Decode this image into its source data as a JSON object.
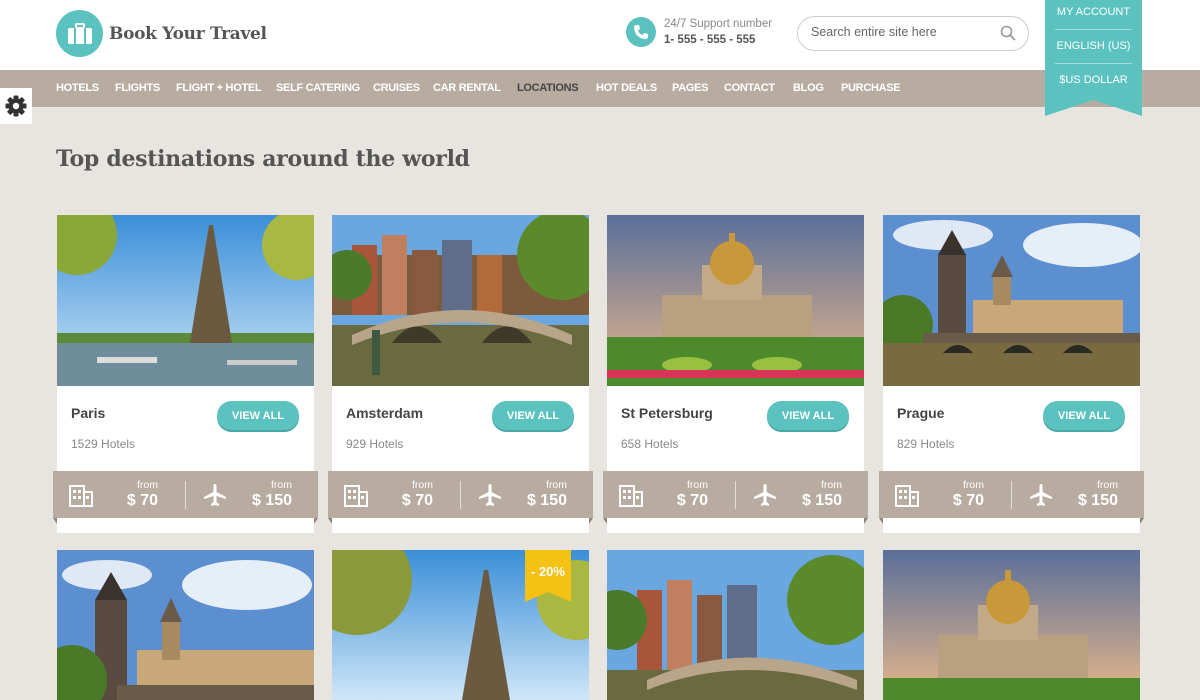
{
  "brand": {
    "name": "Book Your Travel",
    "accent": "#5cc2bf",
    "nav_bg": "#b8aca1"
  },
  "support": {
    "label": "24/7 Support number",
    "number": "1- 555 - 555 - 555"
  },
  "search": {
    "placeholder": "Search entire site here"
  },
  "account_ribbon": {
    "account": "MY ACCOUNT",
    "language": "ENGLISH (US)",
    "currency": "$US DOLLAR"
  },
  "nav": [
    "HOTELS",
    "FLIGHTS",
    "FLIGHT + HOTEL",
    "SELF CATERING",
    "CRUISES",
    "CAR RENTAL",
    "LOCATIONS",
    "HOT DEALS",
    "PAGES",
    "CONTACT",
    "BLOG",
    "PURCHASE"
  ],
  "nav_active": "LOCATIONS",
  "page_title": "Top destinations around the world",
  "cards": [
    {
      "city": "Paris",
      "hotels": "1529 Hotels",
      "button": "VIEW ALL",
      "from_label": "from",
      "hotel_price": "$ 70",
      "flight_price": "$ 150"
    },
    {
      "city": "Amsterdam",
      "hotels": "929 Hotels",
      "button": "VIEW ALL",
      "from_label": "from",
      "hotel_price": "$ 70",
      "flight_price": "$ 150"
    },
    {
      "city": "St Petersburg",
      "hotels": "658 Hotels",
      "button": "VIEW ALL",
      "from_label": "from",
      "hotel_price": "$ 70",
      "flight_price": "$ 150"
    },
    {
      "city": "Prague",
      "hotels": "829 Hotels",
      "button": "VIEW ALL",
      "from_label": "from",
      "hotel_price": "$ 70",
      "flight_price": "$ 150"
    }
  ],
  "second_row": [
    {
      "image": "prague-photo"
    },
    {
      "image": "paris-photo",
      "badge": "- 20%",
      "badge_color": "#f5c115"
    },
    {
      "image": "amsterdam-photo"
    },
    {
      "image": "st-petersburg-photo"
    }
  ],
  "icons": {
    "logo": "suitcase-icon",
    "phone": "phone-icon",
    "search": "search-icon",
    "settings": "gear-icon",
    "hotel": "building-icon",
    "flight": "airplane-icon"
  }
}
